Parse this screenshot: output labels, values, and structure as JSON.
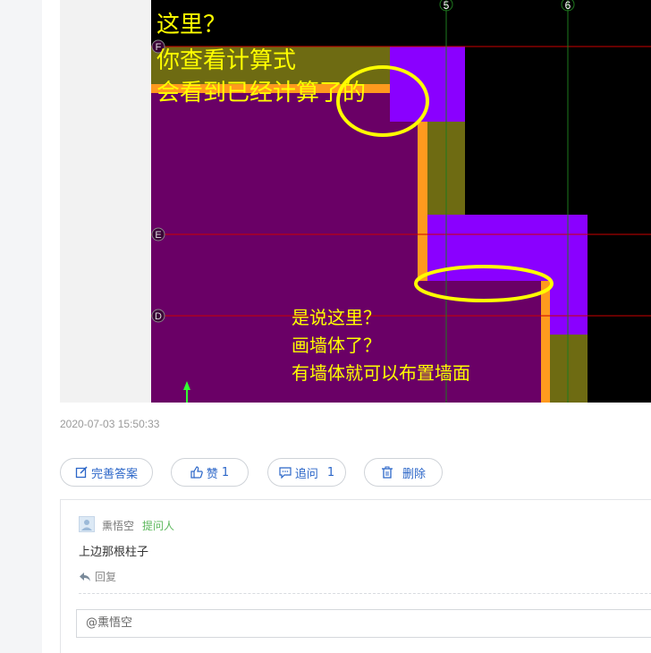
{
  "cad_image": {
    "annotation_top": [
      "这里？",
      "你查看计算式",
      "会看到已经计算了的"
    ],
    "annotation_bottom": [
      "是说这里？",
      "画墙体了？",
      "有墙体就可以布置墙面"
    ],
    "axis_labels": [
      "5",
      "6",
      "F",
      "E",
      "D"
    ],
    "colors": {
      "background": "#000000",
      "slab": "#6a0066",
      "wall": "#6e6b12",
      "column": "#8a00ff",
      "edge": "#ff9a1e",
      "annotation": "#ffff00",
      "highlight_ellipse": "#ffff00",
      "grid": "#cc0000"
    }
  },
  "post": {
    "timestamp": "2020-07-03 15:50:33"
  },
  "actions": {
    "improve_label": "完善答案",
    "like_label": "赞",
    "like_count": "1",
    "followup_label": "追问",
    "followup_count": "1",
    "delete_label": "删除"
  },
  "comment": {
    "username": "熏悟空",
    "role": "提问人",
    "text": "上边那根柱子",
    "reply_label": "回复",
    "input_value": "@熏悟空"
  },
  "icons": {
    "improve": "edit-icon",
    "like": "thumbs-up-icon",
    "followup": "comment-icon",
    "delete": "trash-icon",
    "reply": "reply-arrow-icon"
  }
}
